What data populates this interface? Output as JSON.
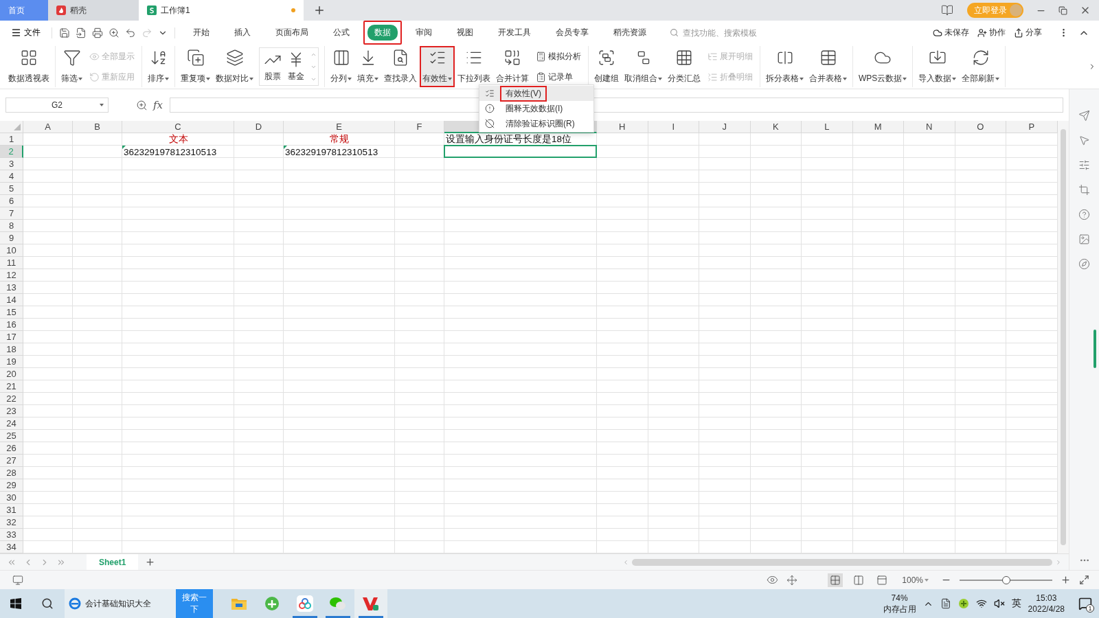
{
  "tabs": [
    {
      "label": "首页",
      "kind": "home",
      "selected": false
    },
    {
      "label": "稻壳",
      "kind": "app",
      "selected": false
    },
    {
      "label": "工作簿1",
      "kind": "doc",
      "selected": true,
      "modified": true
    }
  ],
  "account": {
    "label": "立即登录"
  },
  "menu": {
    "file": "文件",
    "tabs": [
      {
        "label": "开始",
        "selected": false,
        "highlighted": false
      },
      {
        "label": "插入",
        "selected": false,
        "highlighted": false
      },
      {
        "label": "页面布局",
        "selected": false,
        "highlighted": false
      },
      {
        "label": "公式",
        "selected": false,
        "highlighted": false
      },
      {
        "label": "数据",
        "selected": true,
        "highlighted": true
      },
      {
        "label": "审阅",
        "selected": false,
        "highlighted": false
      },
      {
        "label": "视图",
        "selected": false,
        "highlighted": false
      },
      {
        "label": "开发工具",
        "selected": false,
        "highlighted": false
      },
      {
        "label": "会员专享",
        "selected": false,
        "highlighted": false
      },
      {
        "label": "稻壳资源",
        "selected": false,
        "highlighted": false
      }
    ],
    "search": {
      "placeholder": "查找功能、搜索模板"
    },
    "actions": [
      {
        "label": "未保存"
      },
      {
        "label": "协作"
      },
      {
        "label": "分享"
      }
    ]
  },
  "ribbon": [
    [
      {
        "kind": "large",
        "label": "数据透视表",
        "dropdown": false,
        "highlighted": false
      }
    ],
    [
      {
        "kind": "large",
        "label": "筛选",
        "dropdown": true,
        "highlighted": false
      },
      {
        "kind": "stack",
        "items": [
          {
            "label": "全部显示",
            "disabled": true
          },
          {
            "label": "重新应用",
            "disabled": true
          }
        ]
      }
    ],
    [
      {
        "kind": "large",
        "label": "排序",
        "dropdown": true,
        "highlighted": false
      }
    ],
    [
      {
        "kind": "large",
        "label": "重复项",
        "dropdown": true,
        "highlighted": false
      },
      {
        "kind": "large",
        "label": "数据对比",
        "dropdown": true,
        "highlighted": false
      },
      {
        "kind": "gallery",
        "items": [
          {
            "label": "股票"
          },
          {
            "label": "基金"
          }
        ]
      }
    ],
    [
      {
        "kind": "large",
        "label": "分列",
        "dropdown": true,
        "highlighted": false
      },
      {
        "kind": "large",
        "label": "填充",
        "dropdown": true,
        "highlighted": false
      },
      {
        "kind": "large",
        "label": "查找录入",
        "dropdown": false,
        "highlighted": false
      },
      {
        "kind": "large",
        "label": "有效性",
        "dropdown": true,
        "highlighted": true
      },
      {
        "kind": "large",
        "label": "下拉列表",
        "dropdown": false,
        "highlighted": false
      },
      {
        "kind": "large",
        "label": "合并计算",
        "dropdown": false,
        "highlighted": false
      },
      {
        "kind": "stack",
        "items": [
          {
            "label": "模拟分析",
            "disabled": false
          },
          {
            "label": "记录单",
            "disabled": false
          }
        ]
      }
    ],
    [
      {
        "kind": "large",
        "label": "创建组",
        "dropdown": false,
        "highlighted": false
      },
      {
        "kind": "large",
        "label": "取消组合",
        "dropdown": true,
        "highlighted": false
      },
      {
        "kind": "large",
        "label": "分类汇总",
        "dropdown": false,
        "highlighted": false
      },
      {
        "kind": "stack",
        "items": [
          {
            "label": "展开明细",
            "disabled": true
          },
          {
            "label": "折叠明细",
            "disabled": true
          }
        ]
      }
    ],
    [
      {
        "kind": "large",
        "label": "拆分表格",
        "dropdown": true,
        "highlighted": false
      },
      {
        "kind": "large",
        "label": "合并表格",
        "dropdown": true,
        "highlighted": false
      }
    ],
    [
      {
        "kind": "large",
        "label": "WPS云数据",
        "dropdown": true,
        "highlighted": false
      }
    ],
    [
      {
        "kind": "large",
        "label": "导入数据",
        "dropdown": true,
        "highlighted": false
      },
      {
        "kind": "large",
        "label": "全部刷新",
        "dropdown": true,
        "highlighted": false
      }
    ]
  ],
  "dropdown_menu": [
    {
      "label": "有效性(V)",
      "selected": true,
      "highlighted": true
    },
    {
      "label": "圈释无效数据(I)",
      "selected": false,
      "highlighted": false
    },
    {
      "label": "清除验证标识圈(R)",
      "selected": false,
      "highlighted": false
    }
  ],
  "formula_bar": {
    "name_box": "G2",
    "function_label": "fx"
  },
  "sheet": {
    "columns": [
      {
        "label": "A",
        "selected": false
      },
      {
        "label": "B",
        "selected": false
      },
      {
        "label": "C",
        "selected": false
      },
      {
        "label": "D",
        "selected": false
      },
      {
        "label": "E",
        "selected": false
      },
      {
        "label": "F",
        "selected": false
      },
      {
        "selected": true
      },
      {
        "label": "H",
        "selected": false
      },
      {
        "label": "I",
        "selected": false
      },
      {
        "label": "J",
        "selected": false
      },
      {
        "label": "K",
        "selected": false
      },
      {
        "label": "L",
        "selected": false
      },
      {
        "label": "M",
        "selected": false
      },
      {
        "label": "N",
        "selected": false
      },
      {
        "label": "O",
        "selected": false
      },
      {
        "label": "P",
        "selected": false
      }
    ],
    "rows": [
      {
        "label": "1",
        "selected": false,
        "cells": [
          null,
          null,
          {
            "kind": "heading",
            "text": "文本",
            "color": "#c00000"
          },
          null,
          {
            "kind": "heading",
            "text": "常规",
            "color": "#c00000"
          },
          null,
          {
            "kind": "text",
            "text": "设置输入身份证号长度是18位"
          },
          null,
          null,
          null,
          null,
          null,
          null,
          null,
          null,
          null
        ]
      },
      {
        "label": "2",
        "selected": true,
        "cells": [
          null,
          null,
          {
            "kind": "text",
            "text": "362329197812310513",
            "flagged": true
          },
          null,
          {
            "kind": "text",
            "text": "362329197812310513",
            "flagged": true
          },
          null,
          {
            "active": true
          },
          null,
          null,
          null,
          null,
          null,
          null,
          null,
          null,
          null
        ]
      },
      {
        "label": "3",
        "selected": false
      },
      {
        "label": "4",
        "selected": false
      },
      {
        "label": "5",
        "selected": false
      },
      {
        "label": "6",
        "selected": false
      },
      {
        "label": "7",
        "selected": false
      },
      {
        "label": "8",
        "selected": false
      },
      {
        "label": "9",
        "selected": false
      },
      {
        "label": "10",
        "selected": false
      },
      {
        "label": "11",
        "selected": false
      },
      {
        "label": "12",
        "selected": false
      },
      {
        "label": "13",
        "selected": false
      },
      {
        "label": "14",
        "selected": false
      },
      {
        "label": "15",
        "selected": false
      },
      {
        "label": "16",
        "selected": false
      },
      {
        "label": "17",
        "selected": false
      },
      {
        "label": "18",
        "selected": false
      },
      {
        "label": "19",
        "selected": false
      },
      {
        "label": "20",
        "selected": false
      },
      {
        "label": "21",
        "selected": false
      },
      {
        "label": "22",
        "selected": false
      },
      {
        "label": "23",
        "selected": false
      },
      {
        "label": "24",
        "selected": false
      },
      {
        "label": "25",
        "selected": false
      },
      {
        "label": "26",
        "selected": false
      },
      {
        "label": "27",
        "selected": false
      },
      {
        "label": "28",
        "selected": false
      },
      {
        "label": "29",
        "selected": false
      },
      {
        "label": "30",
        "selected": false
      },
      {
        "label": "31",
        "selected": false
      },
      {
        "label": "32",
        "selected": false
      },
      {
        "label": "33",
        "selected": false
      },
      {
        "label": "34",
        "selected": false
      }
    ]
  },
  "sheet_tabs": [
    {
      "label": "Sheet1",
      "selected": true
    }
  ],
  "status_bar": {
    "views": [
      {
        "selected": true
      },
      {
        "selected": false
      },
      {
        "selected": false
      }
    ],
    "zoom": "100%",
    "zoom_slider": {
      "level": 0.5
    }
  },
  "taskbar": {
    "search_text": "会计基础知识大全",
    "search_button": "搜索一下",
    "apps": [
      {
        "running": false
      },
      {
        "running": false
      },
      {
        "running": true
      },
      {
        "running": true
      },
      {
        "running": true
      }
    ],
    "memory": {
      "value": "74%",
      "label": "内存占用"
    },
    "ime": "英",
    "time": "15:03",
    "date": "2022/4/28",
    "notifications": "1"
  }
}
